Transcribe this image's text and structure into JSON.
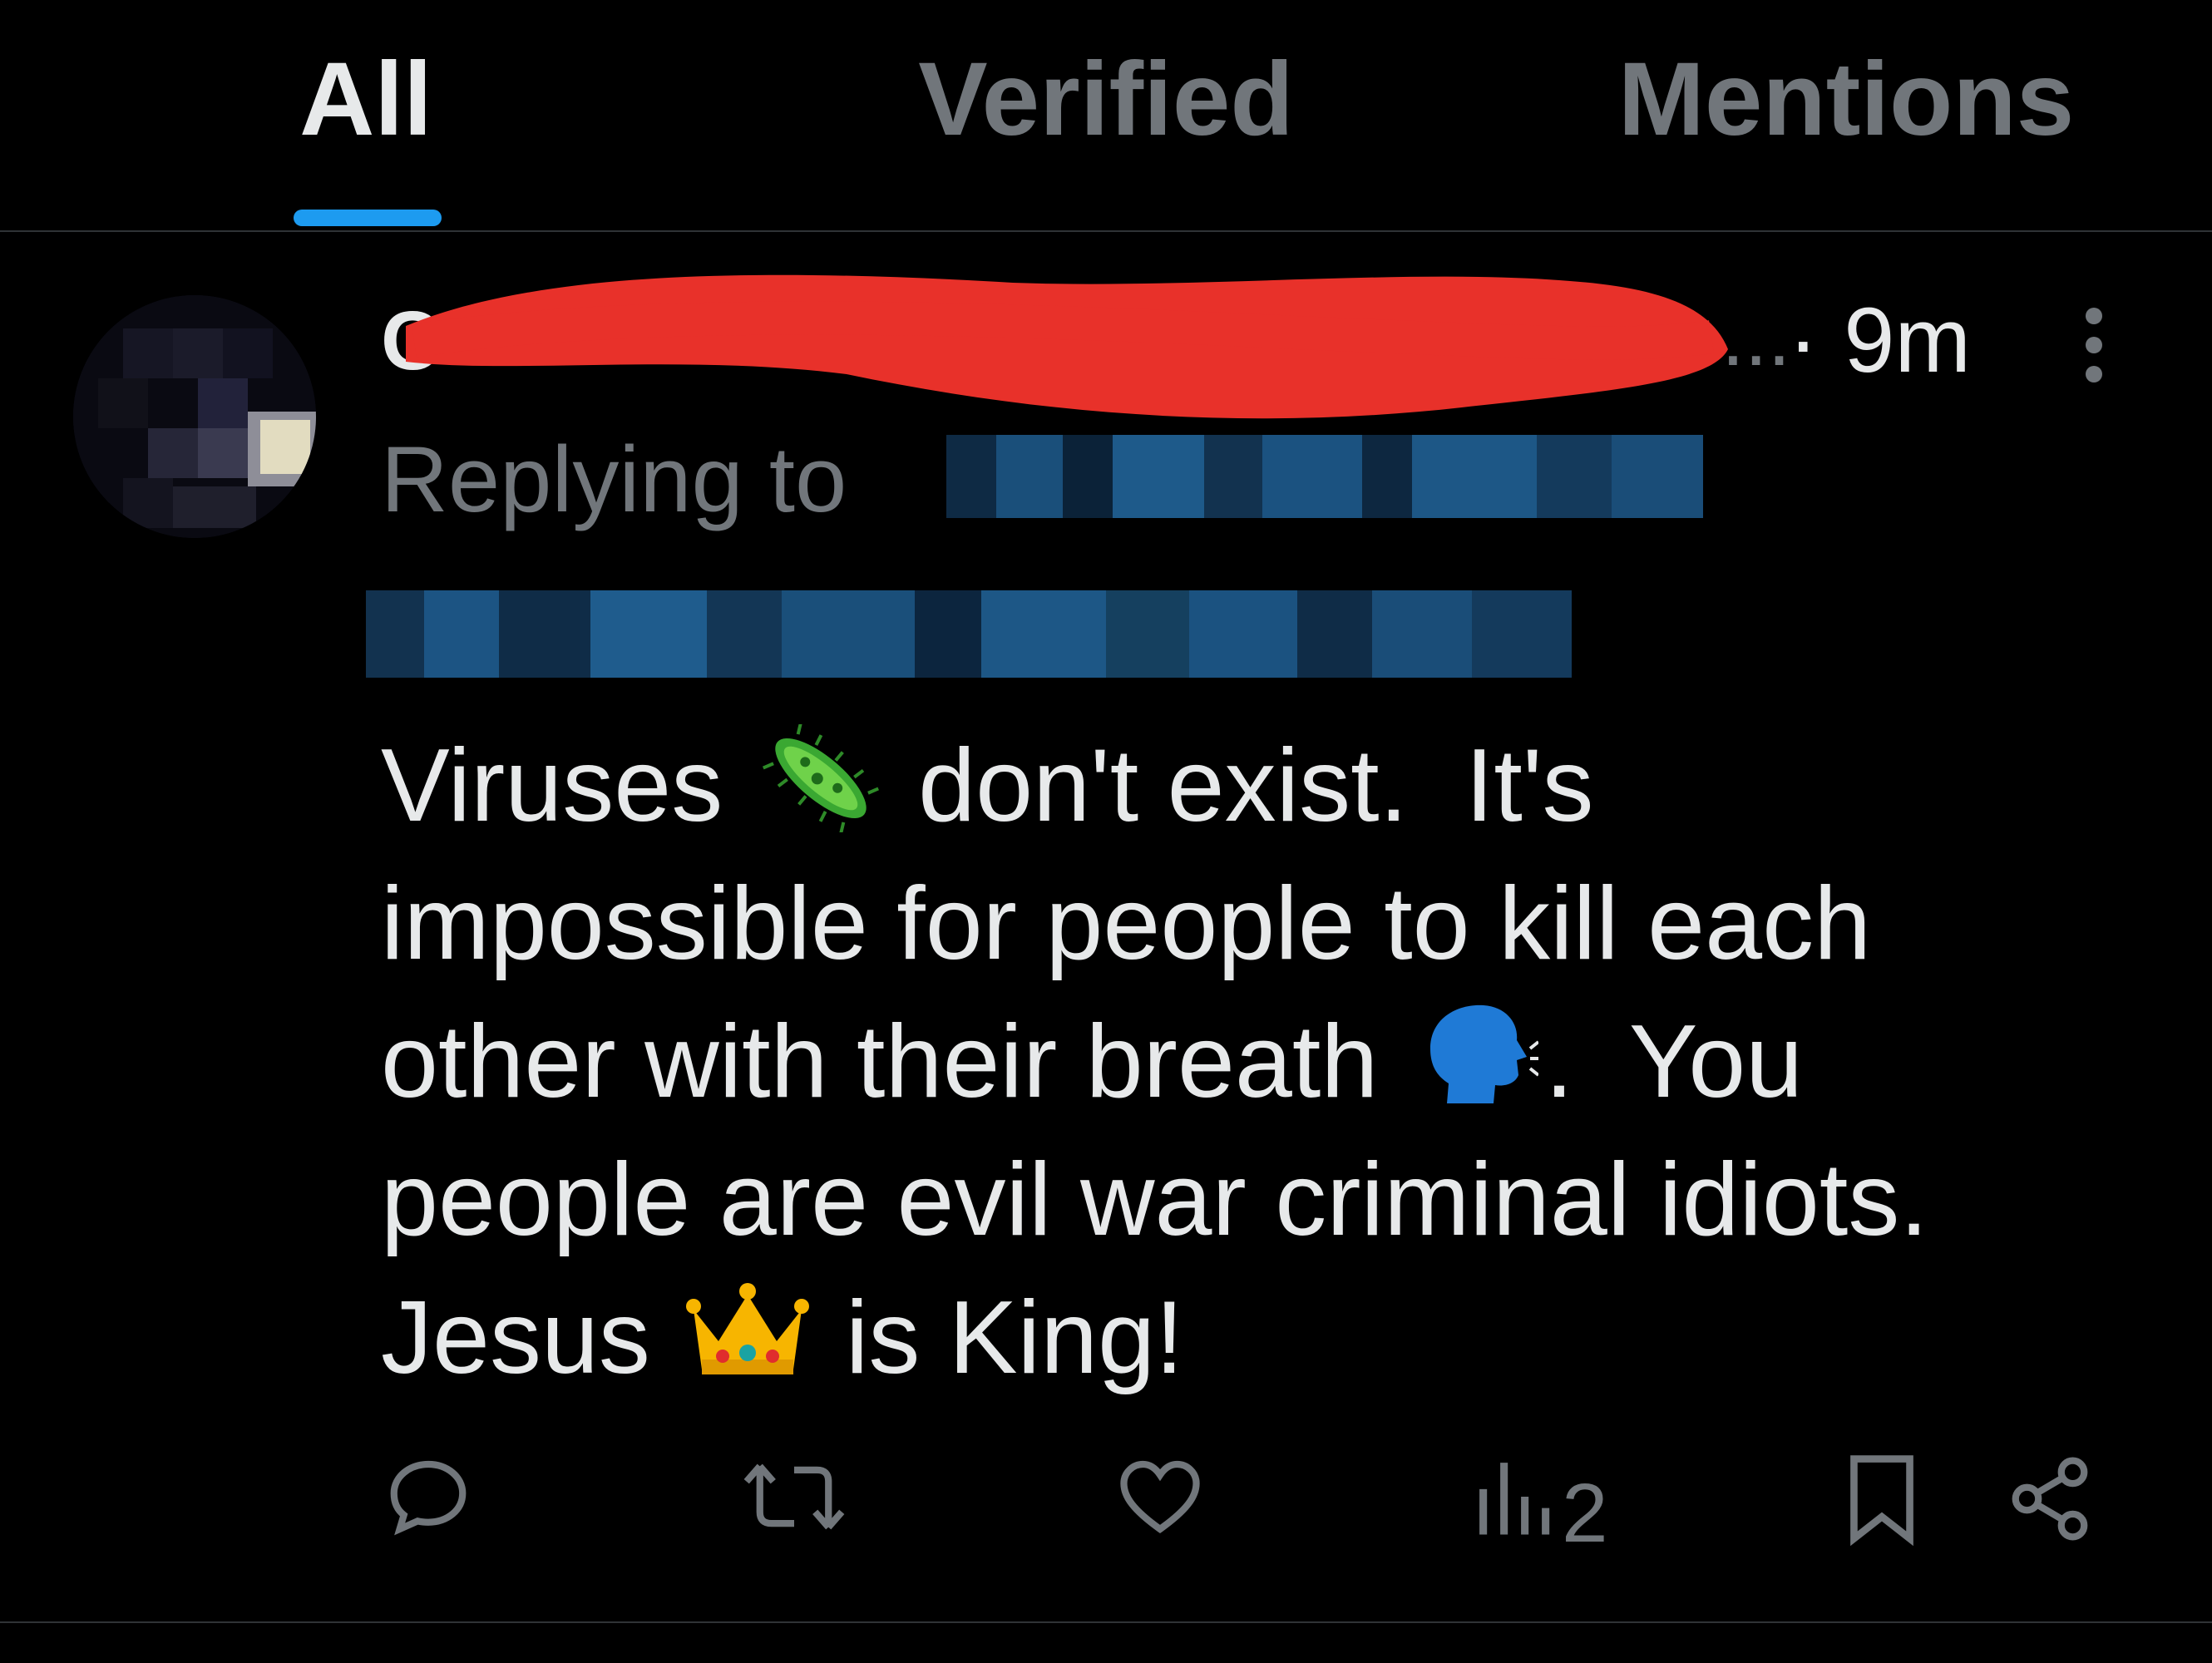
{
  "tabs": [
    {
      "label": "All",
      "active": true
    },
    {
      "label": "Verified",
      "active": false
    },
    {
      "label": "Mentions",
      "active": false
    }
  ],
  "tweet": {
    "name_first_letter": "C",
    "name_tail": "...",
    "time": "· 9m",
    "replying_prefix": "Replying to",
    "text": {
      "line1_a": "Viruses",
      "line1_b": "don't exist.  It's",
      "line2": "impossible for people to kill each",
      "line3_a": "other with their breath",
      "line3_b": ".  You",
      "line4": "people are evil war criminal idiots.",
      "line5_a": "Jesus",
      "line5_b": "is King!"
    },
    "views": "2"
  },
  "colors": {
    "accent": "#1d9bf0",
    "muted": "#71767b",
    "text": "#e7e9ea",
    "redaction": "#e8312a"
  },
  "icons": {
    "reply": "reply-icon",
    "retweet": "retweet-icon",
    "like": "heart-icon",
    "views": "views-icon",
    "bookmark": "bookmark-icon",
    "share": "share-icon"
  }
}
